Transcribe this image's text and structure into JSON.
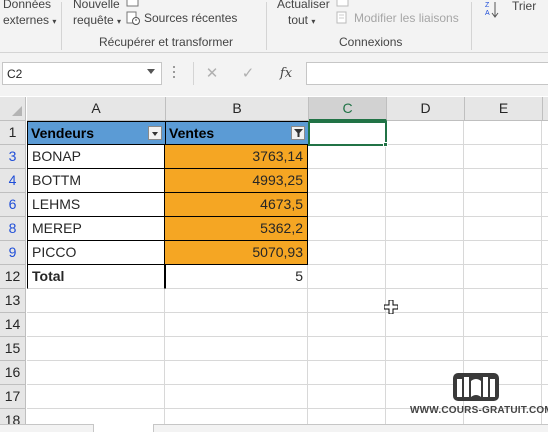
{
  "ribbon": {
    "donnees_externes": [
      "Données",
      "externes"
    ],
    "nouvelle_requete": [
      "Nouvelle",
      "requête"
    ],
    "sources_recentes": "Sources récentes",
    "group_recuperer": "Récupérer et transformer",
    "actualiser": [
      "Actualiser",
      "tout"
    ],
    "modifier_liaisons": "Modifier les liaisons",
    "group_connexions": "Connexions",
    "trier": "Trier"
  },
  "formula_bar": {
    "name_box": "C2",
    "cancel_glyph": "✕",
    "enter_glyph": "✓",
    "fx_glyph": "fx",
    "formula": ""
  },
  "sheet": {
    "columns": [
      "A",
      "B",
      "C",
      "D",
      "E"
    ],
    "selected_column": "C",
    "rows": [
      "1",
      "3",
      "4",
      "6",
      "8",
      "9",
      "12",
      "13",
      "14",
      "15",
      "16",
      "17",
      "18"
    ],
    "header": {
      "a": "Vendeurs",
      "b": "Ventes"
    },
    "data": [
      {
        "vendeur": "BONAP",
        "ventes": "3763,14"
      },
      {
        "vendeur": "BOTTM",
        "ventes": "4993,25"
      },
      {
        "vendeur": "LEHMS",
        "ventes": "4673,5"
      },
      {
        "vendeur": "MEREP",
        "ventes": "5362,2"
      },
      {
        "vendeur": "PICCO",
        "ventes": "5070,93"
      }
    ],
    "total": {
      "label": "Total",
      "value": "5"
    }
  },
  "watermark": {
    "text": "WWW.COURS-GRATUIT.COM"
  },
  "colors": {
    "header_fill": "#5b9bd5",
    "highlight_fill": "#f5a623",
    "accent": "#217346",
    "filtered_row_number": "#1f4ed8"
  }
}
